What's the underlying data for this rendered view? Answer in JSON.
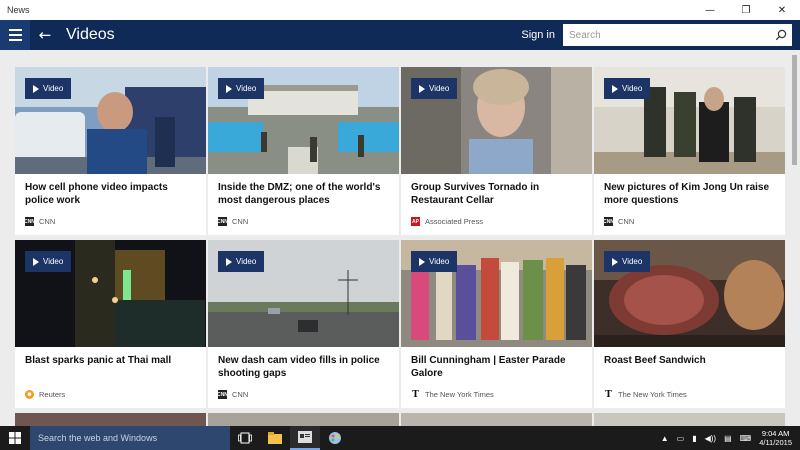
{
  "window": {
    "title": "News",
    "minimize": "—",
    "maximize": "❐",
    "close": "✕"
  },
  "header": {
    "title": "Videos",
    "sign_in": "Sign in",
    "search_placeholder": "Search"
  },
  "badge_label": "Video",
  "cards": [
    {
      "headline": "How cell phone video impacts police work",
      "source": "CNN",
      "logo": "cnn"
    },
    {
      "headline": "Inside the DMZ; one of the world's most dangerous places",
      "source": "CNN",
      "logo": "cnn"
    },
    {
      "headline": "Group Survives Tornado in Restaurant Cellar",
      "source": "Associated Press",
      "logo": "ap"
    },
    {
      "headline": "New pictures of Kim Jong Un raise more questions",
      "source": "CNN",
      "logo": "cnn"
    },
    {
      "headline": "Blast sparks panic at Thai mall",
      "source": "Reuters",
      "logo": "reuters"
    },
    {
      "headline": "New dash cam video fills in police shooting gaps",
      "source": "CNN",
      "logo": "cnn"
    },
    {
      "headline": "Bill Cunningham | Easter Parade Galore",
      "source": "The New York Times",
      "logo": "nyt"
    },
    {
      "headline": "Roast Beef Sandwich",
      "source": "The New York Times",
      "logo": "nyt"
    }
  ],
  "logos": {
    "cnn": "CNN",
    "ap": "AP",
    "reuters": "✺",
    "nyt": "T"
  },
  "taskbar": {
    "search_placeholder": "Search the web and Windows",
    "time": "9:04 AM",
    "date": "4/11/2015"
  },
  "colors": {
    "header": "#0f2a57",
    "badge": "#1c3566",
    "taskbar": "#1b1b1b",
    "taskbar_search": "#2e476f"
  }
}
